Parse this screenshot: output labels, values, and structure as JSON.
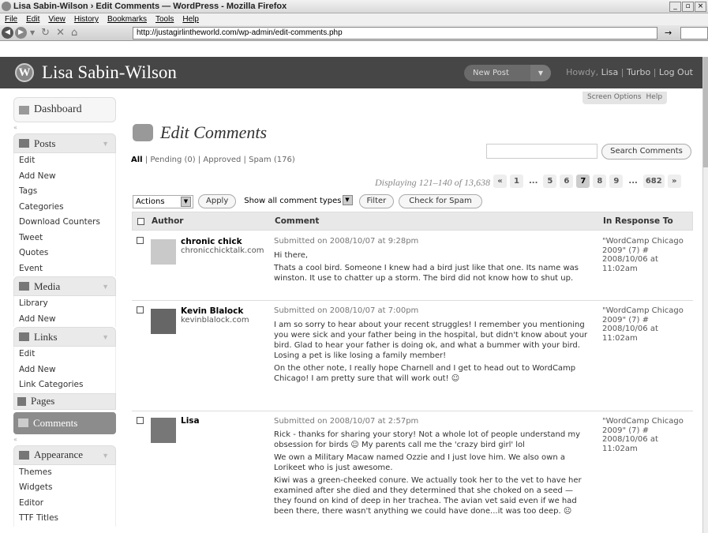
{
  "window": {
    "title": "Lisa Sabin-Wilson › Edit Comments — WordPress - Mozilla Firefox",
    "controls": [
      "_",
      "▫",
      "×"
    ]
  },
  "menu": [
    "File",
    "Edit",
    "View",
    "History",
    "Bookmarks",
    "Tools",
    "Help"
  ],
  "browser": {
    "url": "http://justagirlintheworld.com/wp-admin/edit-comments.php"
  },
  "header": {
    "site_title": "Lisa Sabin-Wilson",
    "new_post": "New Post",
    "howdy": "Howdy,",
    "user": "Lisa",
    "links": [
      "Turbo",
      "Log Out"
    ]
  },
  "sidebar": {
    "dashboard": "Dashboard",
    "posts": {
      "label": "Posts",
      "items": [
        "Edit",
        "Add New",
        "Tags",
        "Categories",
        "Download Counters",
        "Tweet",
        "Quotes",
        "Event"
      ]
    },
    "media": {
      "label": "Media",
      "items": [
        "Library",
        "Add New"
      ]
    },
    "links": {
      "label": "Links",
      "items": [
        "Edit",
        "Add New",
        "Link Categories"
      ]
    },
    "pages": "Pages",
    "comments": "Comments",
    "appearance": {
      "label": "Appearance",
      "items": [
        "Themes",
        "Widgets",
        "Editor",
        "TTF Titles"
      ]
    }
  },
  "screen_options": "Screen Options",
  "help": "Help",
  "page_title": "Edit Comments",
  "status_links": {
    "all": "All",
    "pending": "Pending (0)",
    "approved": "Approved",
    "spam": "Spam (176)"
  },
  "search": {
    "button": "Search Comments",
    "value": ""
  },
  "displaying": "Displaying 121–140 of 13,638",
  "pagination": [
    "«",
    "1",
    "...",
    "5",
    "6",
    "7",
    "8",
    "9",
    "...",
    "682",
    "»"
  ],
  "pagination_current": "7",
  "filters": {
    "actions": "Actions",
    "apply": "Apply",
    "types": "Show all comment types",
    "filter": "Filter",
    "check_spam": "Check for Spam"
  },
  "table": {
    "headers": [
      "Author",
      "Comment",
      "In Response To"
    ],
    "rows": [
      {
        "author": "chronic chick",
        "url": "chronicchicktalk.com",
        "submitted": "Submitted on 2008/10/07 at 9:28pm",
        "paragraphs": [
          "Hi there,",
          "Thats a cool bird. Someone I knew had a bird just like that one. Its name was winston. It use to chatter up a storm. The bird did not know how to shut up."
        ],
        "response": "\"WordCamp Chicago 2009\" (7) # 2008/10/06 at 11:02am"
      },
      {
        "author": "Kevin Blalock",
        "url": "kevinblalock.com",
        "submitted": "Submitted on 2008/10/07 at 7:00pm",
        "paragraphs": [
          "I am so sorry to hear about your recent struggles! I remember you mentioning you were sick and your father being in the hospital, but didn't know about your bird. Glad to hear your father is doing ok, and what a bummer with your bird. Losing a pet is like losing a family member!",
          "On the other note, I really hope Charnell and I get to head out to WordCamp Chicago! I am pretty sure that will work out! ☺"
        ],
        "response": "\"WordCamp Chicago 2009\" (7) # 2008/10/06 at 11:02am"
      },
      {
        "author": "Lisa",
        "url": "",
        "submitted": "Submitted on 2008/10/07 at 2:57pm",
        "paragraphs": [
          "Rick - thanks for sharing your story! Not a whole lot of people understand my obsession for birds ☺ My parents call me the 'crazy bird girl' lol",
          "We own a Military Macaw named Ozzie and I just love him. We also own a Lorikeet who is just awesome.",
          "Kiwi was a green-cheeked conure. We actually took her to the vet to have her examined after she died and they determined that she choked on a seed — they found on kind of deep in her trachea. The avian vet said even if we had been there, there wasn't anything we could have done...it was too deep. ☹"
        ],
        "response": "\"WordCamp Chicago 2009\" (7) # 2008/10/06 at 11:02am"
      }
    ]
  }
}
